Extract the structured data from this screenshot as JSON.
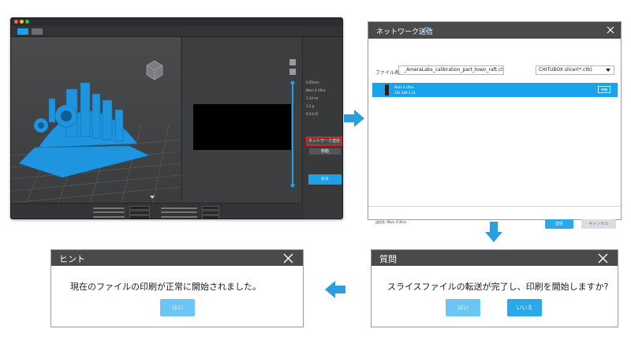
{
  "slicer": {
    "side_values": [
      "0.05mm",
      "Mars 4 Ultra",
      "1.14 ml",
      "1.2 g",
      "0:33:15"
    ],
    "net_send_label": "ネットワーク送信",
    "move_label": "移動",
    "back_label": "戻る"
  },
  "network_dialog": {
    "title": "ネットワーク送信",
    "file_label": "ファイル名:",
    "file_name": "_AmeraLabs_calibration_part_town_raft.ctb",
    "file_type": "CHITUBOX slicer(*.ctb)",
    "printer": {
      "name": "Mars 4 Ultra",
      "ip": "192.168.1.54",
      "status": "待機"
    },
    "destination": "送信先: Mars 4 Ultra",
    "send_label": "送信",
    "cancel_label": "キャンセル"
  },
  "question_dialog": {
    "title": "質問",
    "message": "スライスファイルの転送が完了し、印刷を開始しますか?",
    "yes_label": "はい",
    "no_label": "いいえ"
  },
  "hint_dialog": {
    "title": "ヒント",
    "message": "現在のファイルの印刷が正常に開始されました。",
    "ok_label": "はい"
  },
  "colors": {
    "accent": "#29a8ec",
    "arrow": "#2a9fe0",
    "highlight": "#e02020",
    "header": "#4a4a4c"
  }
}
